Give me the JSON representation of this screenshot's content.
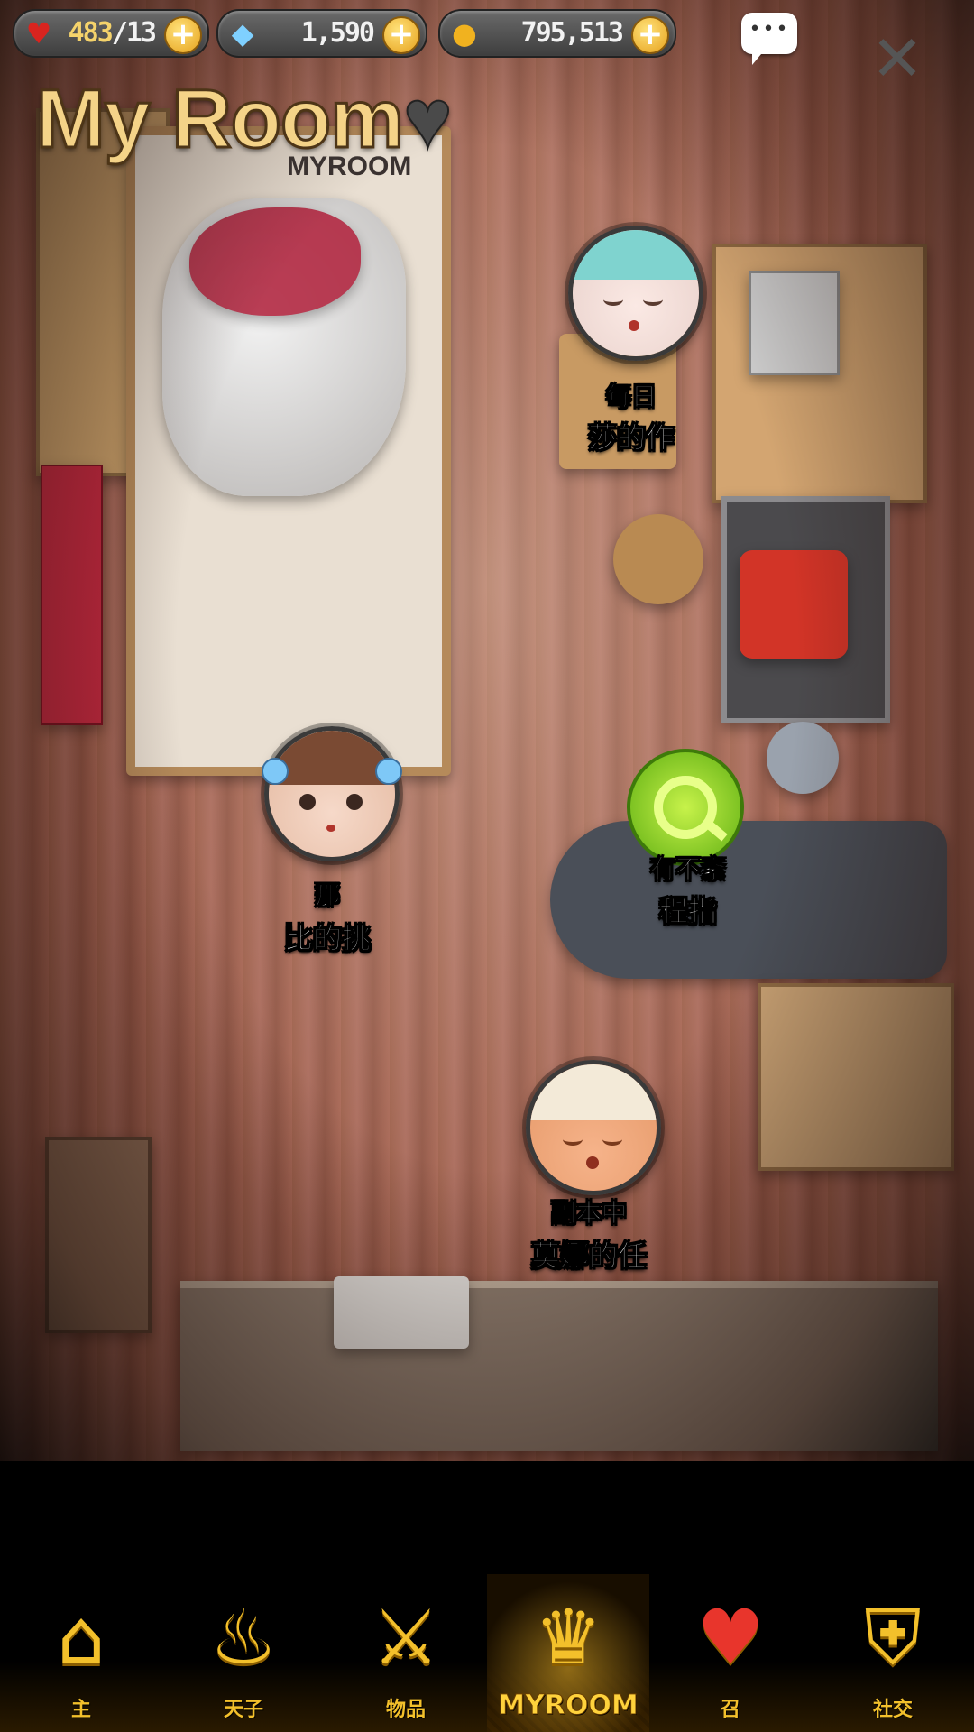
{
  "hud": {
    "stamina": {
      "icon": "heart-icon",
      "current": "483",
      "separator": "/",
      "max": "13"
    },
    "gems": {
      "icon": "crystal-icon",
      "value": "1,590"
    },
    "gold": {
      "icon": "coin-icon",
      "value": "795,513"
    },
    "chat_icon": "chat-bubble-icon",
    "close_icon": "close-icon"
  },
  "title": {
    "text": "My Room",
    "heart": "♥",
    "subtitle": "MYROOM"
  },
  "characters": [
    {
      "status": "每日",
      "quest": "莎的作",
      "avatar": "sleeping-girl-avatar"
    },
    {
      "status": "那",
      "quest": "比的挑",
      "avatar": "brown-hair-girl-avatar"
    },
    {
      "status": "有不紊",
      "quest": "程指",
      "avatar": "green-q-avatar"
    },
    {
      "status": "副本中",
      "quest": "莫娜的任",
      "avatar": "cat-ear-girl-avatar"
    }
  ],
  "nav": [
    {
      "label": "主",
      "icon": "home-arch-icon",
      "glyph": "⌂",
      "active": false
    },
    {
      "label": "天子",
      "icon": "flame-eye-icon",
      "glyph": "♨",
      "active": false
    },
    {
      "label": "物品",
      "icon": "sword-shield-icon",
      "glyph": "⚔",
      "active": false
    },
    {
      "label": "MYROOM",
      "icon": "crown-wreath-icon",
      "glyph": "♛",
      "active": true
    },
    {
      "label": "召",
      "icon": "potion-heart-icon",
      "glyph": "♥",
      "active": false
    },
    {
      "label": "社交",
      "icon": "checkered-shield-icon",
      "glyph": "⛨",
      "active": false
    }
  ],
  "colors": {
    "accent": "#f3c02b",
    "title": "#f4d388"
  }
}
